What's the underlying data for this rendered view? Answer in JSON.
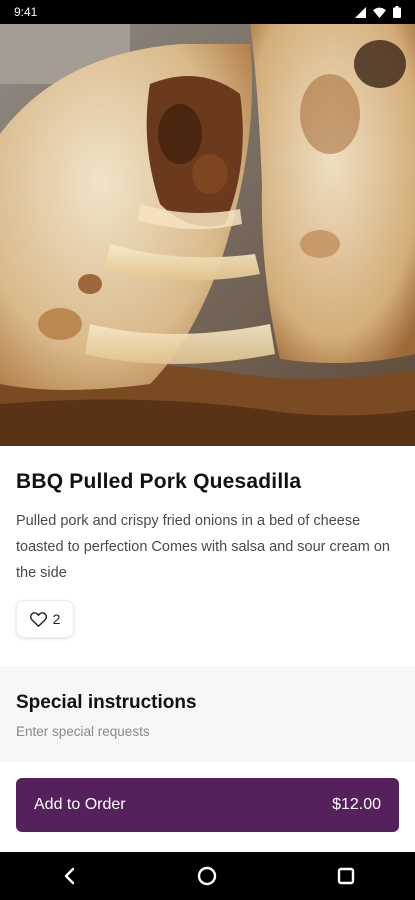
{
  "status_bar": {
    "time": "9:41",
    "icons": [
      "signal-icon",
      "wifi-icon",
      "battery-icon"
    ]
  },
  "hero_image": {
    "alt": "BBQ Pulled Pork Quesadilla"
  },
  "item": {
    "title": "BBQ Pulled Pork Quesadilla",
    "description": "Pulled pork and crispy fried onions in a bed of cheese toasted to perfection Comes with salsa and sour cream on the side",
    "likes": "2"
  },
  "special_instructions": {
    "title": "Special instructions",
    "placeholder": "Enter special requests",
    "value": ""
  },
  "order_button": {
    "label": "Add to Order",
    "price": "$12.00"
  },
  "navigation": {
    "icons": [
      "back-icon",
      "home-icon",
      "recents-icon"
    ]
  },
  "colors": {
    "accent": "#56205c",
    "status_bar": "#000000",
    "section_bg": "#f6f7f9"
  }
}
